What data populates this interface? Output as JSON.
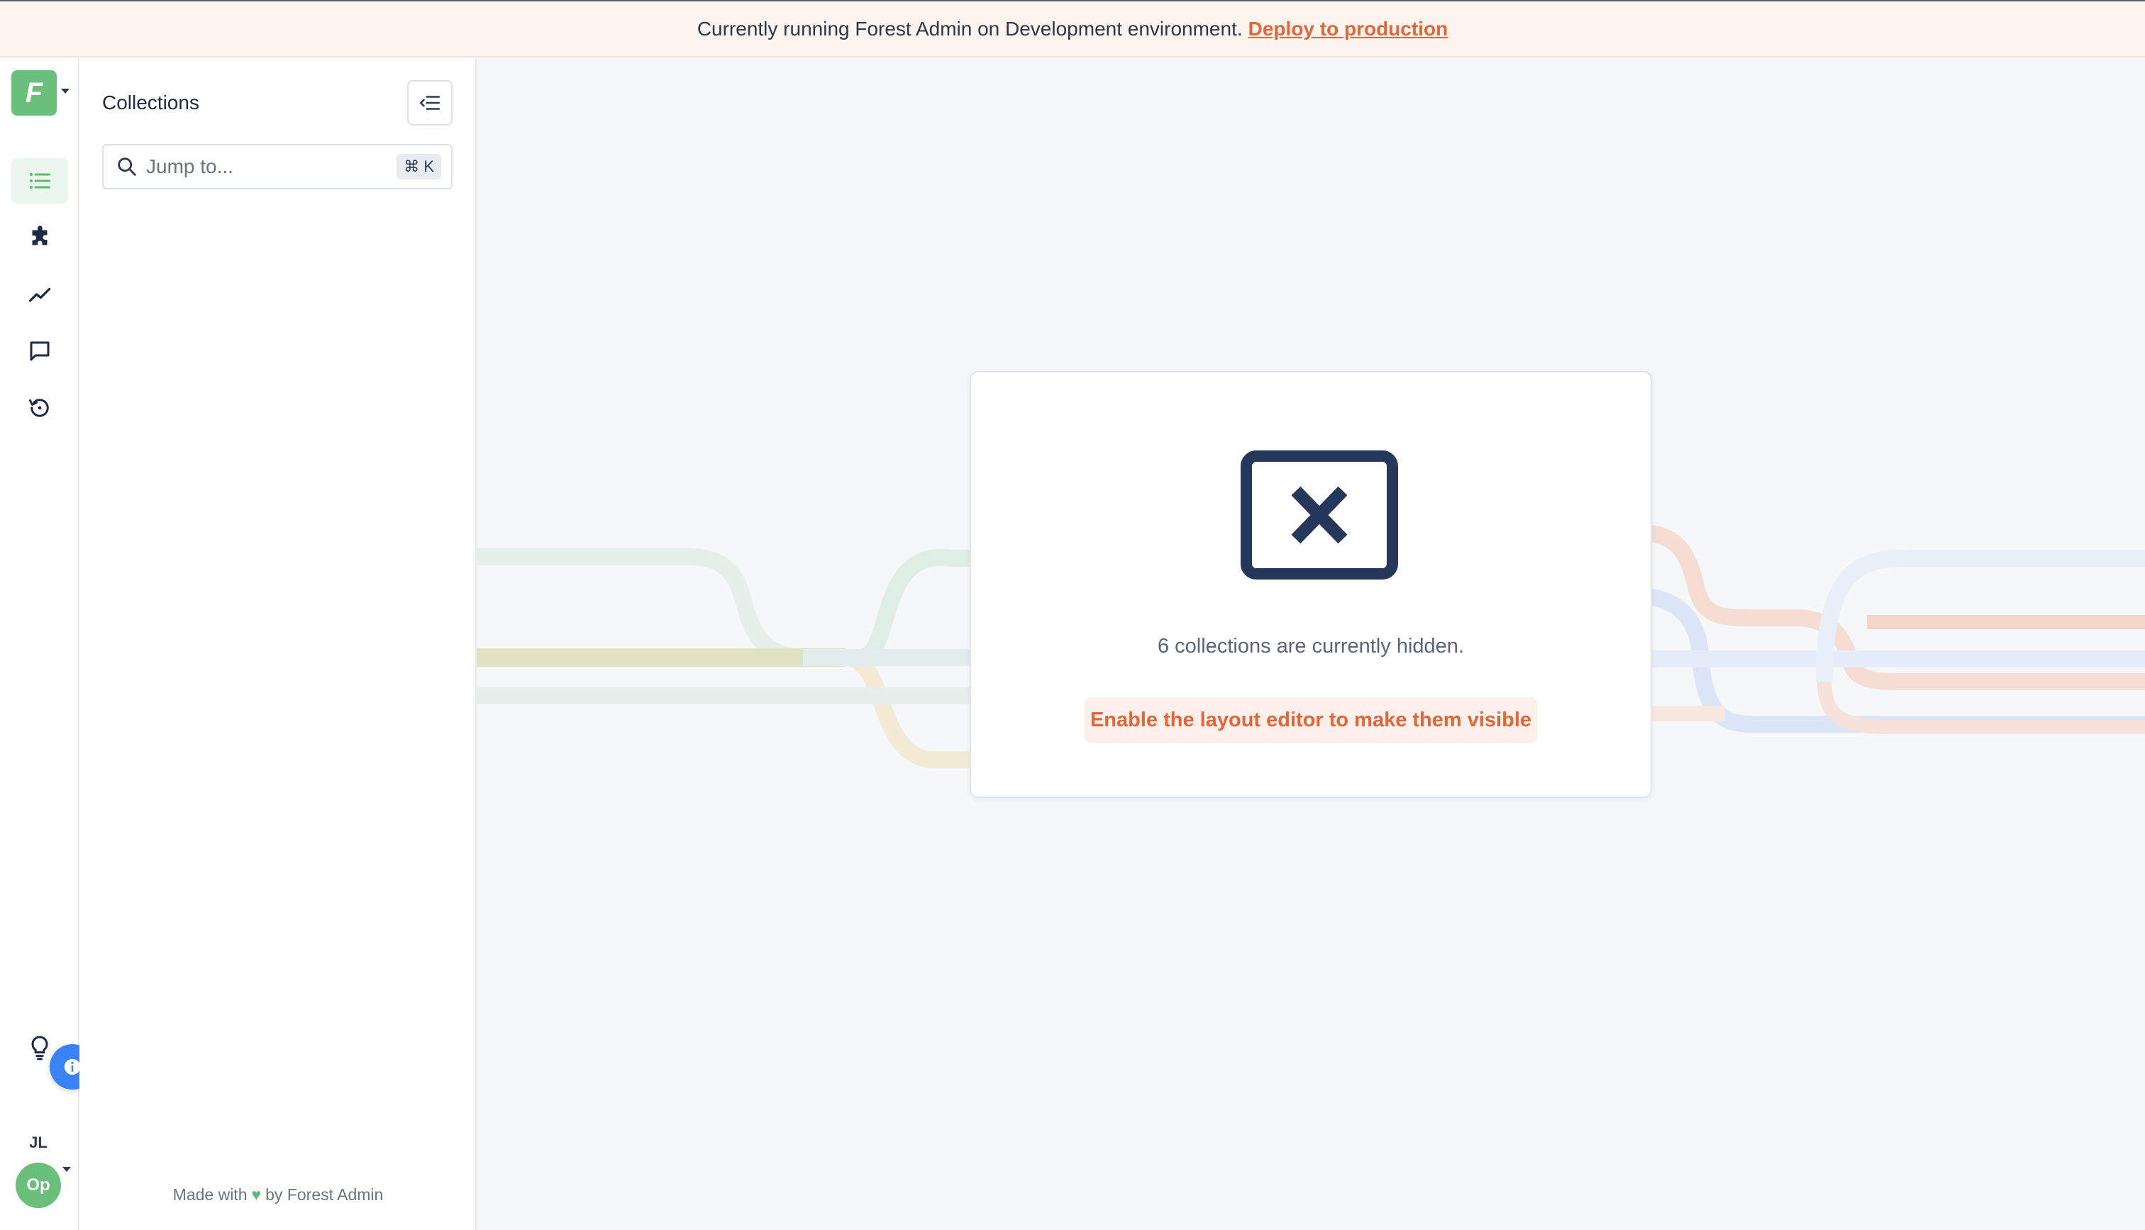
{
  "banner": {
    "message": "Currently running Forest Admin on Development environment.",
    "link_label": "Deploy to production"
  },
  "rail": {
    "logo_letter": "F",
    "items": [
      {
        "icon": "list-icon",
        "active": true
      },
      {
        "icon": "puzzle-icon",
        "active": false
      },
      {
        "icon": "chart-line-icon",
        "active": false
      },
      {
        "icon": "chat-icon",
        "active": false
      },
      {
        "icon": "history-icon",
        "active": false
      }
    ],
    "bottom": {
      "tips_icon": "lightbulb-icon",
      "info_icon": "info-icon",
      "user_initials": "JL",
      "project_initials": "Op"
    }
  },
  "panel": {
    "title": "Collections",
    "search_placeholder": "Jump to...",
    "shortcut": "⌘ K",
    "footer_prefix": "Made with",
    "footer_suffix": "by Forest Admin"
  },
  "main": {
    "message": "6 collections are currently hidden.",
    "enable_label": "Enable the layout editor to make them visible"
  },
  "colors": {
    "brand_green": "#6abf7b",
    "accent_orange": "#e0673a",
    "info_blue": "#3b82f6",
    "navy": "#2b3a55"
  }
}
